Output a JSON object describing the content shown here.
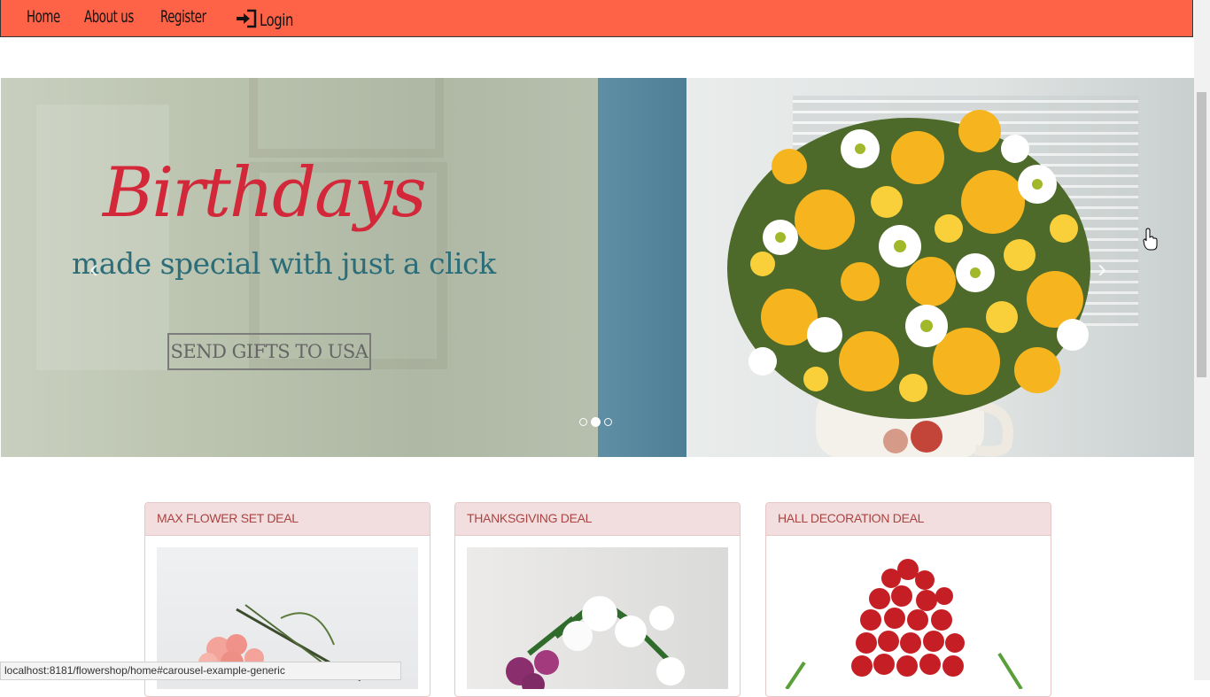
{
  "nav": {
    "items": [
      {
        "label": "Home"
      },
      {
        "label": "About us"
      },
      {
        "label": "Register"
      },
      {
        "label": "Login",
        "icon": "login-icon"
      }
    ]
  },
  "carousel": {
    "headline": "Birthdays",
    "subline": "made special with just a click",
    "cta_label": "SEND GIFTS TO USA",
    "prev_icon": "chevron-left-icon",
    "next_icon": "chevron-right-icon",
    "indicators": {
      "count": 3,
      "active_index": 1
    }
  },
  "deals": [
    {
      "title": "MAX FLOWER SET DEAL"
    },
    {
      "title": "THANKSGIVING DEAL"
    },
    {
      "title": "HALL DECORATION DEAL"
    }
  ],
  "status_bar": {
    "url": "localhost:8181/flowershop/home#carousel-example-generic"
  },
  "colors": {
    "navbar": "#ff6347",
    "headline": "#d2283a",
    "subline": "#2b6d78",
    "panel_head_bg": "#f2dede",
    "panel_head_text": "#a94442"
  }
}
